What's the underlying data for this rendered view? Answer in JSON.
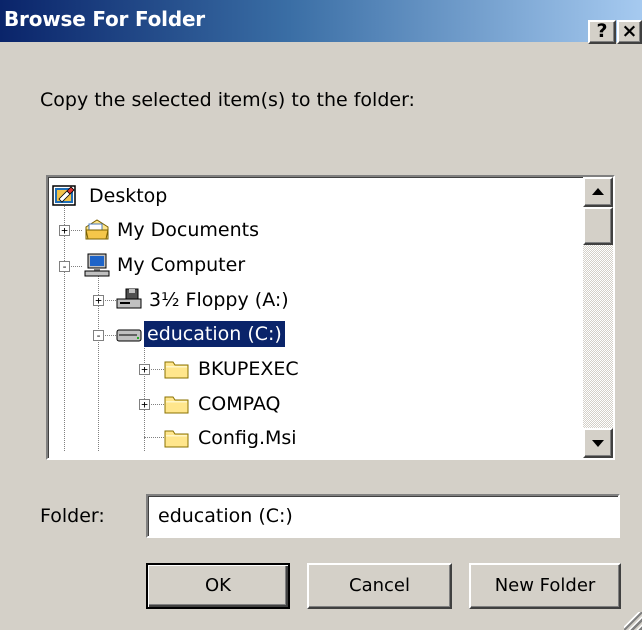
{
  "window": {
    "title": "Browse For Folder",
    "help_glyph": "?",
    "close_glyph": "×"
  },
  "prompt": "Copy the selected item(s) to the folder:",
  "tree": {
    "nodes": [
      {
        "label": "Desktop",
        "icon": "desktop-icon",
        "expander": "",
        "level": 0
      },
      {
        "label": "My Documents",
        "icon": "my-documents-icon",
        "expander": "+",
        "level": 1
      },
      {
        "label": "My Computer",
        "icon": "my-computer-icon",
        "expander": "-",
        "level": 1
      },
      {
        "label": "3½ Floppy (A:)",
        "icon": "floppy-drive-icon",
        "expander": "+",
        "level": 2
      },
      {
        "label": "education (C:)",
        "icon": "hard-drive-icon",
        "expander": "-",
        "level": 2,
        "selected": true
      },
      {
        "label": "BKUPEXEC",
        "icon": "folder-icon",
        "expander": "+",
        "level": 3
      },
      {
        "label": "COMPAQ",
        "icon": "folder-icon",
        "expander": "+",
        "level": 3
      },
      {
        "label": "Config.Msi",
        "icon": "folder-icon",
        "expander": "",
        "level": 3
      }
    ]
  },
  "folder_field": {
    "label": "Folder:",
    "value": "education (C:)"
  },
  "buttons": {
    "ok": "OK",
    "cancel": "Cancel",
    "new_folder": "New Folder"
  },
  "colors": {
    "selection": "#0a246a",
    "dialog_face": "#d4d0c8",
    "folder_yellow": "#ffe68c"
  }
}
